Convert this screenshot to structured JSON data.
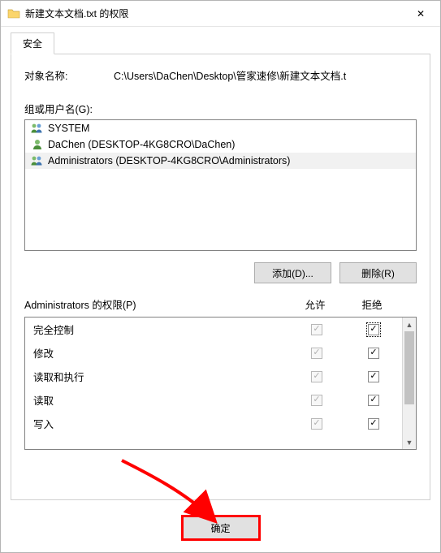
{
  "window": {
    "title": "新建文本文档.txt 的权限",
    "close_glyph": "✕"
  },
  "tab": {
    "security": "安全"
  },
  "object": {
    "label": "对象名称:",
    "path": "C:\\Users\\DaChen\\Desktop\\管家速修\\新建文本文档.t"
  },
  "groups": {
    "label": "组或用户名(G):",
    "items": [
      {
        "name": "SYSTEM",
        "type": "group",
        "selected": false
      },
      {
        "name": "DaChen (DESKTOP-4KG8CRO\\DaChen)",
        "type": "user",
        "selected": false
      },
      {
        "name": "Administrators (DESKTOP-4KG8CRO\\Administrators)",
        "type": "group",
        "selected": true
      }
    ]
  },
  "buttons": {
    "add": "添加(D)...",
    "remove": "删除(R)",
    "ok": "确定"
  },
  "perm": {
    "header_name": "Administrators 的权限(P)",
    "col_allow": "允许",
    "col_deny": "拒绝",
    "rows": [
      {
        "name": "完全控制",
        "allow_checked": true,
        "allow_disabled": true,
        "deny_checked": true,
        "deny_focus": true
      },
      {
        "name": "修改",
        "allow_checked": true,
        "allow_disabled": true,
        "deny_checked": true,
        "deny_focus": false
      },
      {
        "name": "读取和执行",
        "allow_checked": true,
        "allow_disabled": true,
        "deny_checked": true,
        "deny_focus": false
      },
      {
        "name": "读取",
        "allow_checked": true,
        "allow_disabled": true,
        "deny_checked": true,
        "deny_focus": false
      },
      {
        "name": "写入",
        "allow_checked": true,
        "allow_disabled": true,
        "deny_checked": true,
        "deny_focus": false
      }
    ]
  }
}
